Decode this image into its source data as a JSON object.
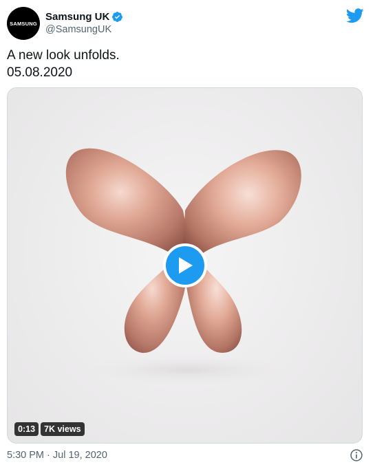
{
  "user": {
    "avatar_text": "SAMSUNG",
    "display_name": "Samsung UK",
    "handle": "@SamsungUK"
  },
  "tweet": {
    "line1": "A new look unfolds.",
    "line2": "05.08.2020"
  },
  "video": {
    "duration": "0:13",
    "views": "7K views"
  },
  "footer": {
    "timestamp": "5:30 PM · Jul 19, 2020"
  },
  "icons": {
    "verified": "verified-badge-icon",
    "platform": "twitter-bird-icon",
    "play": "play-icon",
    "info": "info-icon"
  },
  "colors": {
    "accent": "#1d9bf0",
    "text": "#0f1419",
    "secondary_text": "#536471"
  }
}
